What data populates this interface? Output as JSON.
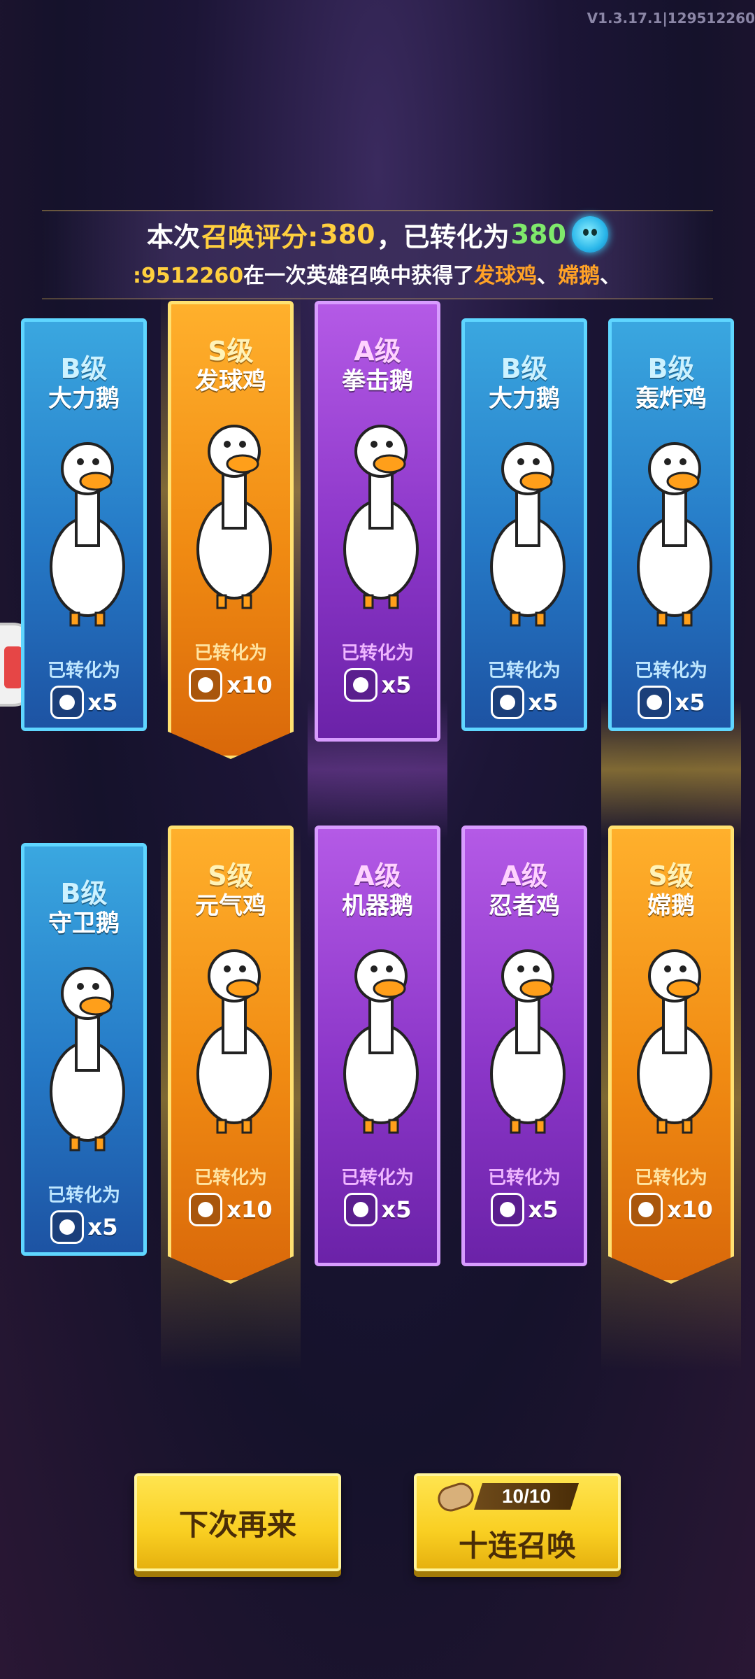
{
  "version": "V1.3.17.1|129512260",
  "header": {
    "score_prefix": "本次",
    "score_highlight": "召唤评分:",
    "score_value": "380",
    "converted_prefix": "，已转化为",
    "converted_value": "380",
    "currency_icon": "blue-ghost-icon"
  },
  "broadcast": {
    "player_id": ":9512260",
    "middle": "在一次英雄召唤中获得了",
    "hero1": "发球鸡",
    "sep": "、",
    "hero2": "嫦鹅",
    "tail": "、"
  },
  "cards": [
    {
      "grade": "B级",
      "name": "大力鹅",
      "converted_label": "已转化为",
      "count": "x5",
      "tier": "B"
    },
    {
      "grade": "S级",
      "name": "发球鸡",
      "converted_label": "已转化为",
      "count": "x10",
      "tier": "S"
    },
    {
      "grade": "A级",
      "name": "拳击鹅",
      "converted_label": "已转化为",
      "count": "x5",
      "tier": "A"
    },
    {
      "grade": "B级",
      "name": "大力鹅",
      "converted_label": "已转化为",
      "count": "x5",
      "tier": "B"
    },
    {
      "grade": "B级",
      "name": "轰炸鸡",
      "converted_label": "已转化为",
      "count": "x5",
      "tier": "B"
    },
    {
      "grade": "B级",
      "name": "守卫鹅",
      "converted_label": "已转化为",
      "count": "x5",
      "tier": "B"
    },
    {
      "grade": "S级",
      "name": "元气鸡",
      "converted_label": "已转化为",
      "count": "x10",
      "tier": "S"
    },
    {
      "grade": "A级",
      "name": "机器鹅",
      "converted_label": "已转化为",
      "count": "x5",
      "tier": "A"
    },
    {
      "grade": "A级",
      "name": "忍者鸡",
      "converted_label": "已转化为",
      "count": "x5",
      "tier": "A"
    },
    {
      "grade": "S级",
      "name": "嫦鹅",
      "converted_label": "已转化为",
      "count": "x10",
      "tier": "S"
    }
  ],
  "buttons": {
    "later": "下次再来",
    "ten_counter": "10/10",
    "ten_label": "十连召唤"
  },
  "colors": {
    "B": "#2a86cf",
    "A": "#9b45d8",
    "S": "#f59a19",
    "accent_gold": "#ffcf3e",
    "accent_green": "#7fe96b",
    "button_yellow": "#f9cf22"
  }
}
